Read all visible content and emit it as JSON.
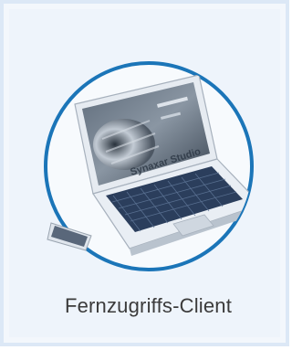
{
  "tile": {
    "label": "Fernzugriffs-Client",
    "icon": "laptop-remote-access-icon"
  },
  "screen": {
    "brand_text": "Synaxar Studio"
  },
  "colors": {
    "ring": "#1b75b8",
    "tile_background": "#eef4fb",
    "keyboard_keys": "#2b3e5c",
    "laptop_body": "#e9eef4"
  }
}
